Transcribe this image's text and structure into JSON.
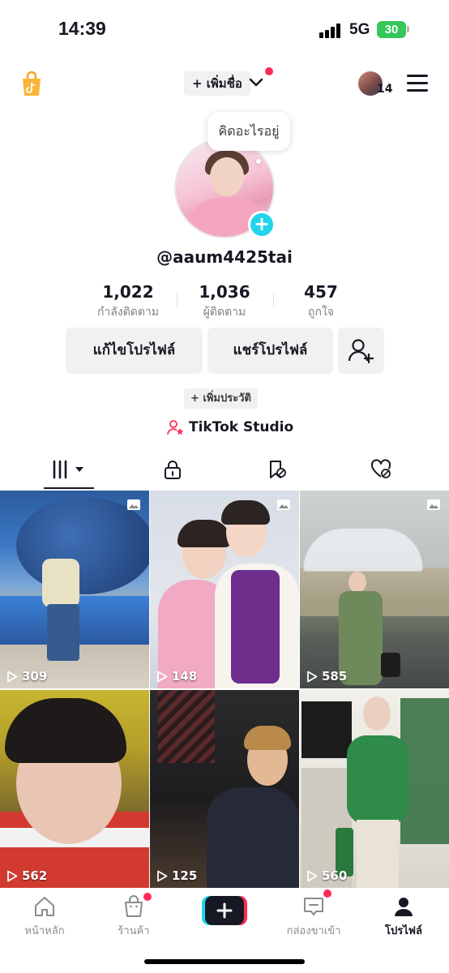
{
  "status_bar": {
    "time": "14:39",
    "network": "5G",
    "battery": "30"
  },
  "header": {
    "add_name_label": "+ เพิ่มชื่อ",
    "friends_count": "14"
  },
  "profile": {
    "bubble_text": "คิดอะไรอยู่",
    "username": "@aaum4425tai",
    "stats": [
      {
        "value": "1,022",
        "label": "กำลังติดตาม"
      },
      {
        "value": "1,036",
        "label": "ผู้ติดตาม"
      },
      {
        "value": "457",
        "label": "ถูกใจ"
      }
    ],
    "edit_profile_label": "แก้ไขโปรไฟล์",
    "share_profile_label": "แชร์โปรไฟล์",
    "add_bio_label": "+ เพิ่มประวัติ",
    "studio_label": "TikTok Studio"
  },
  "tabs": [
    "videos-grid-icon",
    "lock-icon",
    "tagged-icon",
    "liked-icon"
  ],
  "videos": [
    {
      "views": "309"
    },
    {
      "views": "148"
    },
    {
      "views": "585"
    },
    {
      "views": "562"
    },
    {
      "views": "125"
    },
    {
      "views": "560"
    }
  ],
  "nav": {
    "home": "หน้าหลัก",
    "shop": "ร้านค้า",
    "inbox": "กล่องขาเข้า",
    "profile": "โปรไฟล์"
  },
  "colors": {
    "accent_red": "#fe2c55",
    "accent_cyan": "#20d5ec",
    "text": "#161823",
    "muted": "#8a8b91"
  }
}
